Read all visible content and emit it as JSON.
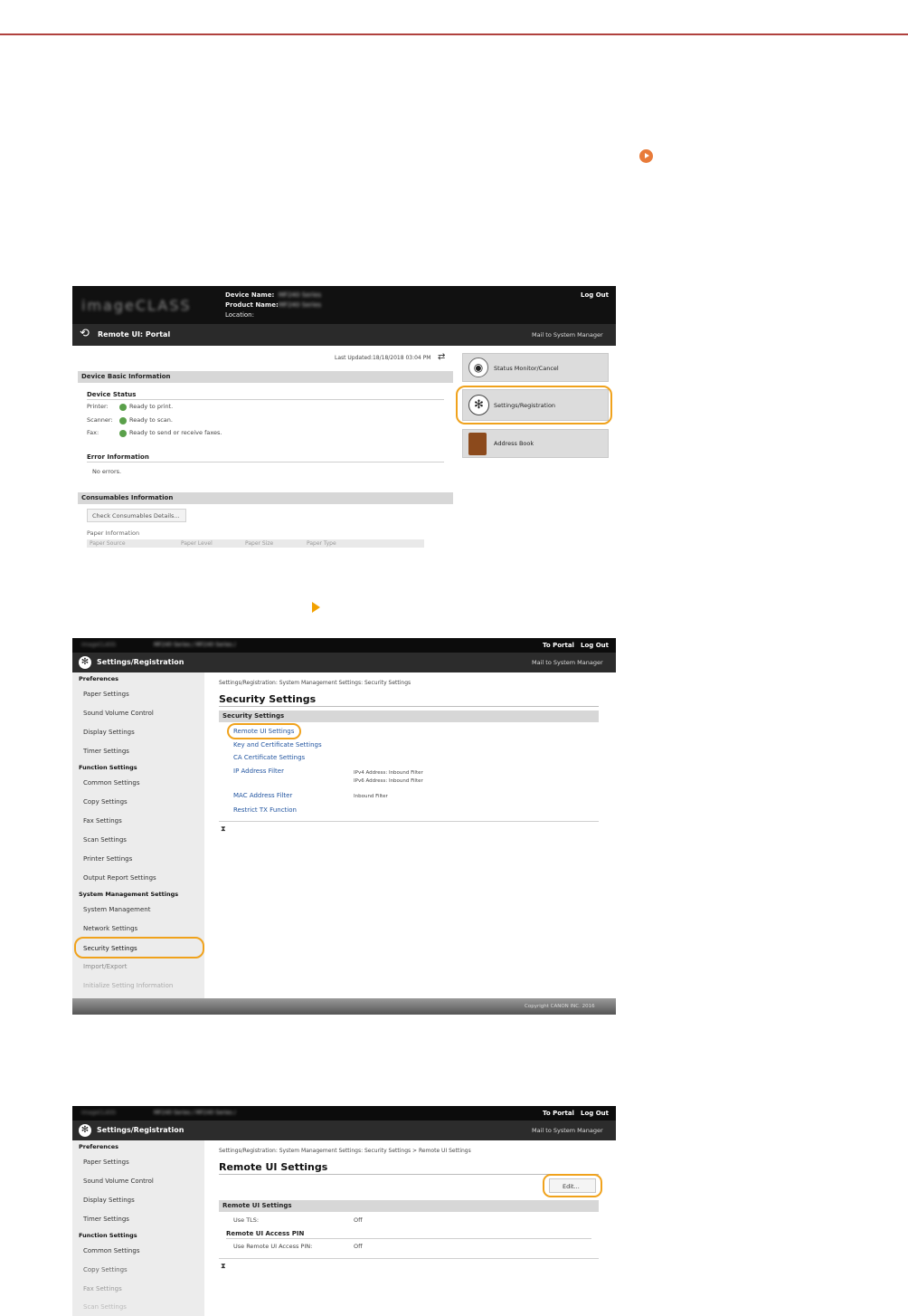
{
  "shot1": {
    "brand": "imageCLASS",
    "device_name_label": "Device Name:",
    "device_name_value": "MF240 Series",
    "product_name_label": "Product Name:",
    "product_name_value": "MF240 Series",
    "location_label": "Location:",
    "logout": "Log Out",
    "portal_title": "Remote UI: Portal",
    "mail": "Mail to System Manager",
    "last_updated": "Last Updated:18/18/2018 03:04 PM",
    "device_basic_info": "Device Basic Information",
    "device_status": "Device Status",
    "status_rows": [
      {
        "label": "Printer:",
        "value": "Ready to print."
      },
      {
        "label": "Scanner:",
        "value": "Ready to scan."
      },
      {
        "label": "Fax:",
        "value": "Ready to send or receive faxes."
      }
    ],
    "error_information": "Error Information",
    "no_errors": "No errors.",
    "consumables_information": "Consumables Information",
    "check_consumables": "Check Consumables Details...",
    "paper_information": "Paper Information",
    "paper_cols": [
      "Paper Source",
      "Paper Level",
      "Paper Size",
      "Paper Type"
    ],
    "tiles": [
      "Status Monitor/Cancel",
      "Settings/Registration",
      "Address Book"
    ]
  },
  "shot2": {
    "topbar_text": "MF240 Series / MF240 Series /",
    "to_portal": "To Portal",
    "logout": "Log Out",
    "title": "Settings/Registration",
    "mail": "Mail to System Manager",
    "sidebar": [
      {
        "type": "group",
        "label": "Preferences"
      },
      {
        "type": "item",
        "label": "Paper Settings"
      },
      {
        "type": "item",
        "label": "Sound Volume Control"
      },
      {
        "type": "item",
        "label": "Display Settings"
      },
      {
        "type": "item",
        "label": "Timer Settings"
      },
      {
        "type": "group",
        "label": "Function Settings"
      },
      {
        "type": "item",
        "label": "Common Settings"
      },
      {
        "type": "item",
        "label": "Copy Settings"
      },
      {
        "type": "item",
        "label": "Fax Settings"
      },
      {
        "type": "item",
        "label": "Scan Settings"
      },
      {
        "type": "item",
        "label": "Printer Settings"
      },
      {
        "type": "item",
        "label": "Output Report Settings"
      },
      {
        "type": "group",
        "label": "System Management Settings"
      },
      {
        "type": "item",
        "label": "System Management"
      },
      {
        "type": "item",
        "label": "Network Settings"
      },
      {
        "type": "item",
        "label": "Security Settings"
      },
      {
        "type": "item",
        "label": "Import/Export"
      },
      {
        "type": "item",
        "label": "Initialize Setting Information"
      }
    ],
    "breadcrumb": "Settings/Registration: System Management Settings: Security Settings",
    "page_title": "Security Settings",
    "section": "Security Settings",
    "links": [
      "Remote UI Settings",
      "Key and Certificate Settings",
      "CA Certificate Settings",
      "IP Address Filter",
      "MAC Address Filter",
      "Restrict TX Function"
    ],
    "ip_desc_1": "IPv4 Address: Inbound Filter",
    "ip_desc_2": "IPv6 Address: Inbound Filter",
    "mac_desc": "Inbound Filter",
    "copyright": "Copyright CANON INC. 2016"
  },
  "shot3": {
    "topbar_text": "MF240 Series / MF240 Series /",
    "to_portal": "To Portal",
    "logout": "Log Out",
    "title": "Settings/Registration",
    "mail": "Mail to System Manager",
    "sidebar": [
      {
        "type": "group",
        "label": "Preferences"
      },
      {
        "type": "item",
        "label": "Paper Settings"
      },
      {
        "type": "item",
        "label": "Sound Volume Control"
      },
      {
        "type": "item",
        "label": "Display Settings"
      },
      {
        "type": "item",
        "label": "Timer Settings"
      },
      {
        "type": "group",
        "label": "Function Settings"
      },
      {
        "type": "item",
        "label": "Common Settings"
      },
      {
        "type": "item",
        "label": "Copy Settings"
      },
      {
        "type": "item",
        "label": "Fax Settings"
      },
      {
        "type": "item",
        "label": "Scan Settings"
      }
    ],
    "breadcrumb": "Settings/Registration: System Management Settings: Security Settings > Remote UI Settings",
    "page_title": "Remote UI Settings",
    "edit": "Edit...",
    "section": "Remote UI Settings",
    "use_tls_label": "Use TLS:",
    "use_tls_value": "Off",
    "access_pin_heading": "Remote UI Access PIN",
    "use_pin_label": "Use Remote UI Access PIN:",
    "use_pin_value": "Off"
  }
}
